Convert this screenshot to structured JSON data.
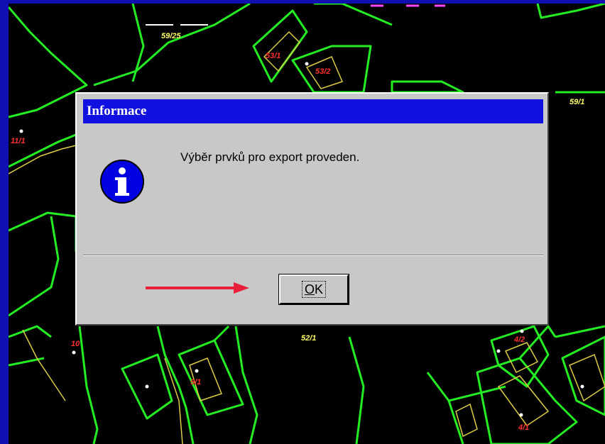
{
  "map": {
    "parcel_labels": [
      {
        "text": "59/25",
        "color": "yellow"
      },
      {
        "text": "53/1",
        "color": "red"
      },
      {
        "text": "53/2",
        "color": "red"
      },
      {
        "text": "59/1",
        "color": "yellow"
      },
      {
        "text": "11/1",
        "color": "red"
      },
      {
        "text": "52/1",
        "color": "yellow"
      },
      {
        "text": "10",
        "color": "red"
      },
      {
        "text": "9/1",
        "color": "red"
      },
      {
        "text": "4/2",
        "color": "red"
      },
      {
        "text": "4/1",
        "color": "red"
      }
    ],
    "line_color": "#22ee22",
    "building_color": "#ddcc44"
  },
  "dialog": {
    "title": "Informace",
    "message": "Výběr prvků pro export proveden.",
    "icon": "information-icon",
    "ok_button": {
      "label_underlined": "O",
      "label_rest": "K"
    }
  },
  "annotation": {
    "arrow_color": "#e8203c"
  }
}
